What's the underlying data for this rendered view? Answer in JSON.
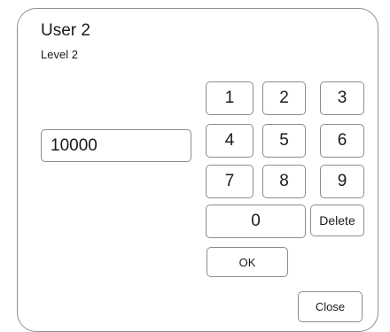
{
  "dialog": {
    "title": "User 2",
    "subtitle": "Level 2"
  },
  "input": {
    "value": "10000"
  },
  "keypad": {
    "k1": "1",
    "k2": "2",
    "k3": "3",
    "k4": "4",
    "k5": "5",
    "k6": "6",
    "k7": "7",
    "k8": "8",
    "k9": "9",
    "k0": "0",
    "delete": "Delete",
    "ok": "OK",
    "close": "Close"
  }
}
